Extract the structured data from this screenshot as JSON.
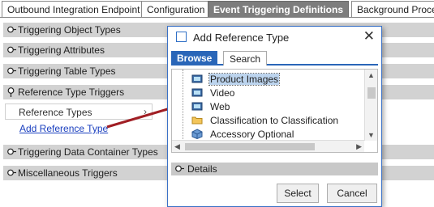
{
  "tabs": [
    {
      "label": "Outbound Integration Endpoint",
      "active": false
    },
    {
      "label": "Configuration",
      "active": false
    },
    {
      "label": "Event Triggering Definitions",
      "active": true
    },
    {
      "label": "Background Process",
      "active": false
    }
  ],
  "sections": {
    "triggering_object_types": "Triggering Object Types",
    "triggering_attributes": "Triggering Attributes",
    "triggering_table_types": "Triggering Table Types",
    "reference_type_triggers": "Reference Type Triggers",
    "triggering_data_container_types": "Triggering Data Container Types",
    "miscellaneous_triggers": "Miscellaneous Triggers"
  },
  "reference_types": {
    "label": "Reference Types",
    "chevron": "›",
    "add_link": "Add Reference Type"
  },
  "dialog": {
    "title": "Add Reference Type",
    "close": "✕",
    "tabs": {
      "browse": "Browse",
      "search": "Search"
    },
    "tree_items": [
      {
        "label": "Product Images",
        "icon": "image-reference-icon",
        "selected": true
      },
      {
        "label": "Video",
        "icon": "image-reference-icon",
        "selected": false
      },
      {
        "label": "Web",
        "icon": "image-reference-icon",
        "selected": false
      },
      {
        "label": "Classification to Classification",
        "icon": "folder-icon",
        "selected": false
      },
      {
        "label": "Accessory Optional",
        "icon": "cube-icon",
        "selected": false
      }
    ],
    "details_label": "Details",
    "buttons": {
      "select": "Select",
      "cancel": "Cancel"
    }
  },
  "colors": {
    "accent": "#2a66b8",
    "section_bg": "#d2d2d2",
    "active_tab_bg": "#7d7d7d",
    "link": "#1a3fbf",
    "arrow": "#a01e24"
  }
}
